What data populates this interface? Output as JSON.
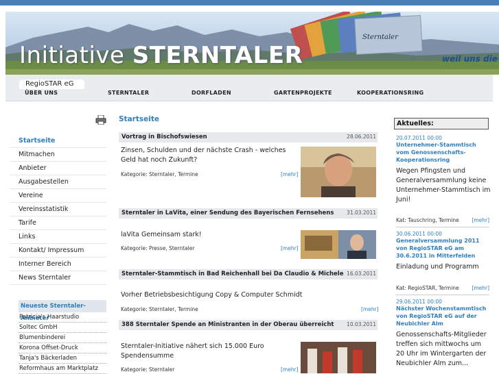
{
  "banner": {
    "title_a": "Initiative ",
    "title_b": "STERNTALER",
    "slogan": "weil uns die R",
    "card_label": "Sterntaler"
  },
  "nav": {
    "active_tab": "RegioSTAR eG",
    "items": [
      "ÜBER UNS",
      "STERNTALER",
      "DORFLADEN",
      "GARTENPROJEKTE",
      "KOOPERATIONSRING"
    ]
  },
  "sidebar": {
    "items": [
      "Startseite",
      "Mitmachen",
      "Anbieter",
      "Ausgabestellen",
      "Vereine",
      "Vereinsstatistik",
      "Tarife",
      "Links",
      "Kontakt/ Impressum",
      "Interner Bereich",
      "News Sterntaler"
    ]
  },
  "newest": {
    "title": "Neueste Sterntaler-Anbieter",
    "items": [
      "Patricia's Haarstudio",
      "Soltec GmbH",
      "Blumenbinderei",
      "Korona Offset-Druck",
      "Tanja's Bäckerladen",
      "Reformhaus am Marktplatz"
    ]
  },
  "page_title": "Startseite",
  "articles": [
    {
      "title": "Vortrag in Bischofswiesen",
      "date": "28.06.2011",
      "teaser": "Zinsen, Schulden und der nächste Crash - welches Geld hat noch Zukunft?",
      "kategorie": "Kategorie: Sterntaler, Termine",
      "mehr": "[mehr]"
    },
    {
      "title": "Sterntaler in LaVita, einer Sendung des Bayerischen Fernsehens",
      "date": "31.03.2011",
      "teaser": "laVita Gemeinsam stark!",
      "kategorie": "Kategorie: Presse, Sterntaler",
      "mehr": "[mehr]"
    },
    {
      "title": "Sterntaler-Stammtisch in Bad Reichenhall bei Da Claudio & Michele",
      "date": "16.03.2011",
      "teaser": "Vorher Betriebsbesichtigung Copy & Computer Schmidt",
      "kategorie": "Kategorie: Sterntaler, Termine",
      "mehr": "[mehr]"
    },
    {
      "title": "388 Sterntaler Spende an Ministranten in der Oberau überreicht",
      "date": "10.03.2011",
      "teaser": "Sterntaler-Initiative nähert sich 15.000 Euro Spendensumme",
      "kategorie": "Kategorie: Sterntaler",
      "mehr": "[mehr]"
    }
  ],
  "aktuelles": {
    "title": "Aktuelles:",
    "items": [
      {
        "date": "20.07.2011 00:00",
        "title": "Unternehmer-Stammtisch vom Genossenschafts-Kooperationsring",
        "text": "Wegen Pfingsten und Generalversammlung keine Unternehmer-Stammtisch im Juni!",
        "kategorie": "Kat: Tauschring, Termine",
        "mehr": "[mehr]"
      },
      {
        "date": "30.06.2011 00:00",
        "title": "Generalversammlung 2011 von RegioSTAR eG am 30.6.2011 in Mitterfelden",
        "text": "Einladung und Programm",
        "kategorie": "Kat: RegioSTAR, Termine",
        "mehr": "[mehr]"
      },
      {
        "date": "29.06.2011 00:00",
        "title": "Nächster Wochenstammtisch von RegioSTAR eG auf der Neubichler Alm",
        "text": "Genossenschafts-Mitglieder treffen sich mittwochs um 20 Uhr im Wintergarten der Neubichler Alm zum..."
      }
    ]
  },
  "colors": {
    "accent": "#2f7fc0",
    "header_bar": "#4a7fb6",
    "nav_bg": "#eaedf0"
  }
}
